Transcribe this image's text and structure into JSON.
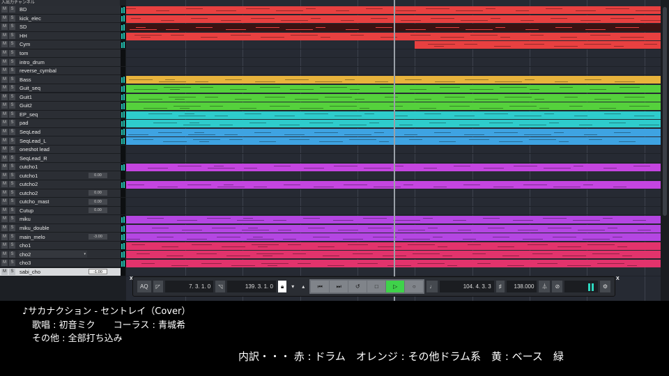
{
  "header": {
    "title": "入出力チャンネル"
  },
  "tracks": [
    {
      "name": "BD",
      "color": "#e84040"
    },
    {
      "name": "kick_elec",
      "color": "#e84040"
    },
    {
      "name": "SD",
      "color": "#3a1212"
    },
    {
      "name": "HH",
      "color": "#e84040"
    },
    {
      "name": "Cym",
      "color": "#e84040"
    },
    {
      "name": "tom"
    },
    {
      "name": "intro_drum"
    },
    {
      "name": "reverse_cymbal"
    },
    {
      "name": "Bass",
      "color": "#e8b33c"
    },
    {
      "name": "Guit_seq",
      "color": "#55d13c"
    },
    {
      "name": "Guit1",
      "color": "#55d13c"
    },
    {
      "name": "Guit2",
      "color": "#55d13c"
    },
    {
      "name": "EP_seq",
      "color": "#2ecccc"
    },
    {
      "name": "pad",
      "color": "#2ecccc"
    },
    {
      "name": "SeqLead",
      "color": "#3ea3e2"
    },
    {
      "name": "SeqLead_L",
      "color": "#3ea3e2"
    },
    {
      "name": "oneshot lead"
    },
    {
      "name": "SeqLead_R"
    },
    {
      "name": "cutcho1",
      "color": "#c445e0"
    },
    {
      "name": "cutcho1",
      "volume": "0.00"
    },
    {
      "name": "cutcho2",
      "color": "#c445e0"
    },
    {
      "name": "cutcho2",
      "volume": "0.00"
    },
    {
      "name": "cutcho_mast",
      "volume": "0.00"
    },
    {
      "name": "Cutup",
      "volume": "0.00"
    },
    {
      "name": "miku",
      "color": "#b446e2"
    },
    {
      "name": "miku_double",
      "color": "#b446e2"
    },
    {
      "name": "main_melo",
      "volume": "-3.00",
      "color": "#b446e2"
    },
    {
      "name": "cho1",
      "color": "#e2336c"
    },
    {
      "name": "cho2",
      "color": "#e2336c"
    },
    {
      "name": "cho3",
      "color": "#e2336c"
    },
    {
      "name": "sabi_cho",
      "volume": "-1.00"
    }
  ],
  "ms": {
    "mute": "M",
    "solo": "S"
  },
  "transport": {
    "aq": "AQ",
    "left_locator": "7. 3. 1.  0",
    "right_locator": "139. 3. 1.  0",
    "position": "104. 4. 3.  3",
    "tempo": "138.000",
    "close": "X"
  },
  "caption": {
    "line1": "♪サカナクション - セントレイ（Cover）",
    "line2": "歌唱 : 初音ミク　　コーラス : 青城希",
    "line3": "その他 : 全部打ち込み",
    "legend": "内訳・・・ 赤 : ドラム　オレンジ : その他ドラム系　黄 : ベース　緑"
  }
}
